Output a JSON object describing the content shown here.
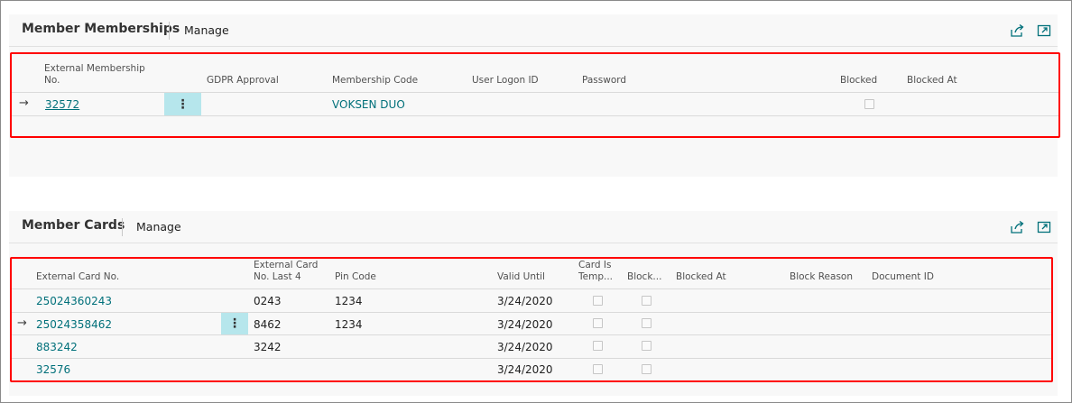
{
  "colors": {
    "accent": "#00707a",
    "highlight_box": "#ff0000",
    "menu_cell_bg": "#b6e6ec"
  },
  "memberships": {
    "title": "Member Memberships",
    "manage_label": "Manage",
    "share_icon": "share-icon",
    "expand_icon": "expand-icon",
    "columns": {
      "external_membership_no_line1": "External Membership",
      "external_membership_no_line2": "No.",
      "gdpr_approval": "GDPR Approval",
      "membership_code": "Membership Code",
      "user_logon_id": "User Logon ID",
      "password": "Password",
      "blocked": "Blocked",
      "blocked_at": "Blocked At"
    },
    "rows": [
      {
        "external_membership_no": "32572",
        "membership_code": "VOKSEN DUO",
        "blocked": false,
        "selected": true
      }
    ]
  },
  "cards": {
    "title": "Member Cards",
    "manage_label": "Manage",
    "share_icon": "share-icon",
    "expand_icon": "expand-icon",
    "columns": {
      "external_card_no": "External Card No.",
      "last4_line1": "External Card",
      "last4_line2": "No. Last 4",
      "pin_code": "Pin Code",
      "valid_until": "Valid Until",
      "temp_line1": "Card Is",
      "temp_line2": "Temp...",
      "blocked": "Block...",
      "blocked_at": "Blocked At",
      "block_reason": "Block Reason",
      "document_id": "Document ID"
    },
    "rows": [
      {
        "external_card_no": "25024360243",
        "last4": "0243",
        "pin_code": "1234",
        "valid_until": "3/24/2020"
      },
      {
        "external_card_no": "25024358462",
        "last4": "8462",
        "pin_code": "1234",
        "valid_until": "3/24/2020"
      },
      {
        "external_card_no": "883242",
        "last4": "3242",
        "pin_code": "",
        "valid_until": "3/24/2020"
      },
      {
        "external_card_no": "32576",
        "last4": "",
        "pin_code": "",
        "valid_until": "3/24/2020"
      }
    ]
  }
}
